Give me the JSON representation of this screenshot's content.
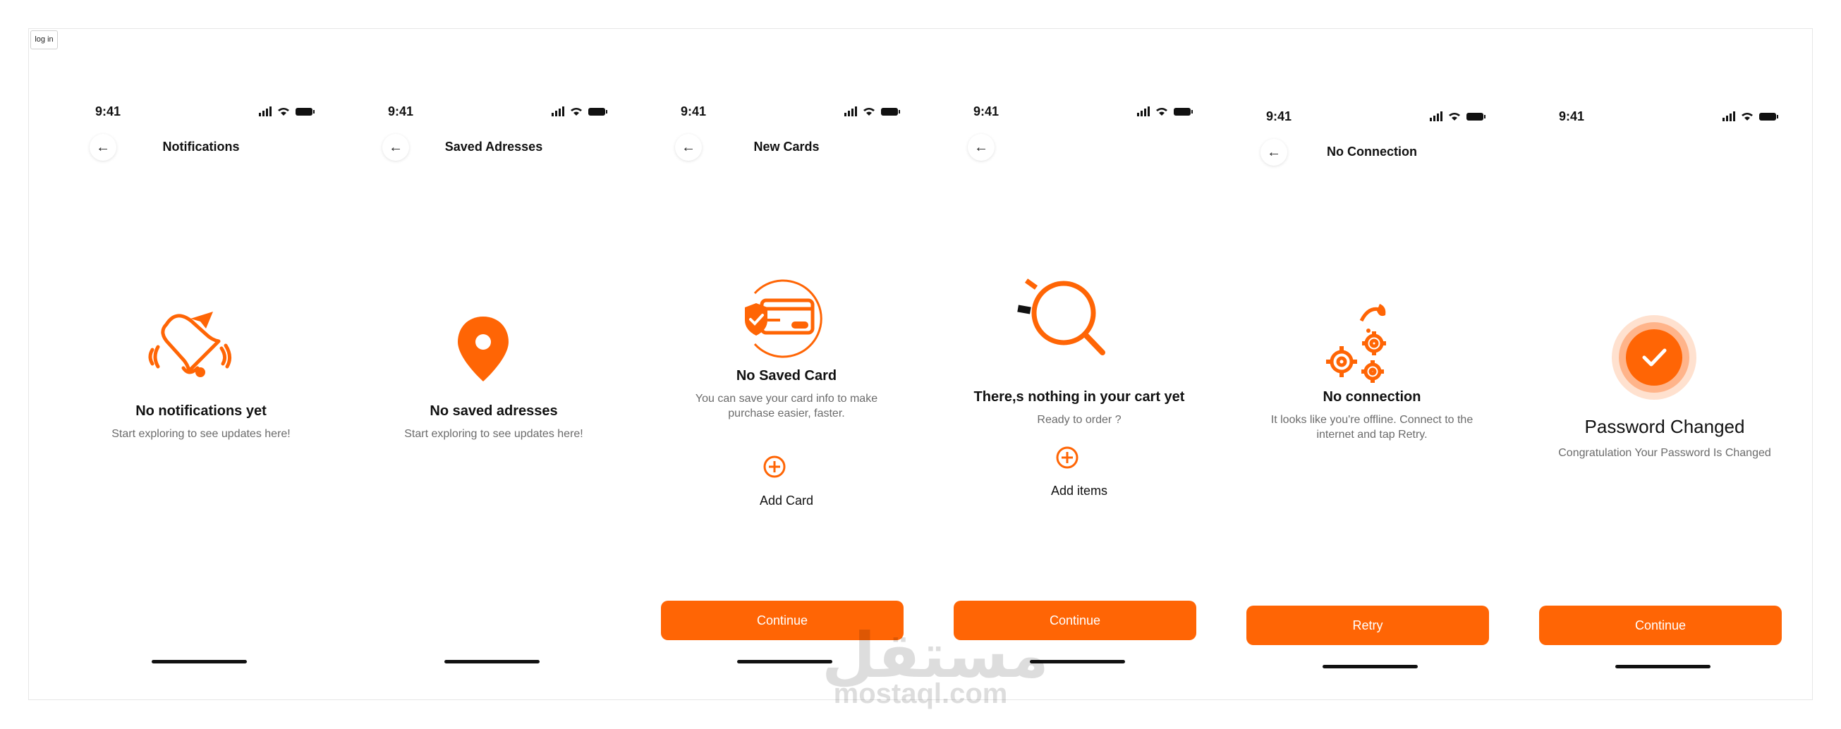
{
  "login_tag": "log in",
  "brand_color": "#ff6505",
  "watermark": {
    "arabic": "مستقل",
    "latin": "mostaql.com"
  },
  "screens": [
    {
      "time": "9:41",
      "title": "Notifications",
      "icon": "bell-icon",
      "heading": "No notifications yet",
      "subtext": "Start exploring to see updates here!"
    },
    {
      "time": "9:41",
      "title": "Saved Adresses",
      "icon": "location-pin-icon",
      "heading": "No saved adresses",
      "subtext": "Start exploring to see updates here!"
    },
    {
      "time": "9:41",
      "title": "New Cards",
      "icon": "credit-card-shield-icon",
      "heading": "No Saved Card",
      "subtext": "You can save your card info to make purchase easier, faster.",
      "add_label": "Add Card",
      "button": "Continue"
    },
    {
      "time": "9:41",
      "title": "",
      "icon": "magnifier-icon",
      "heading": "There,s nothing in your cart yet",
      "subtext": "Ready to order ?",
      "add_label": "Add items",
      "button": "Continue"
    },
    {
      "time": "9:41",
      "title": "No Connection",
      "icon": "broken-gears-icon",
      "heading": "No connection",
      "subtext": "It looks like you're offline. Connect to the internet and tap Retry.",
      "button": "Retry"
    },
    {
      "time": "9:41",
      "title": "",
      "icon": "success-check-icon",
      "heading": "Password Changed",
      "subtext": "Congratulation Your Password Is Changed",
      "button": "Continue"
    }
  ]
}
